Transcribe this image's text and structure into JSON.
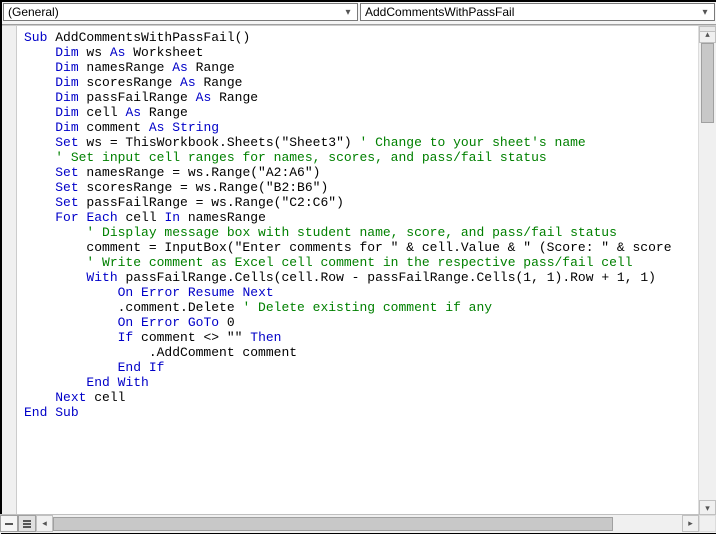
{
  "dropdowns": {
    "object": "(General)",
    "procedure": "AddCommentsWithPassFail"
  },
  "code": {
    "lines": [
      {
        "seg": [
          {
            "t": "Sub",
            "c": "kw"
          },
          {
            "t": " AddCommentsWithPassFail()"
          }
        ]
      },
      {
        "seg": [
          {
            "t": "    "
          },
          {
            "t": "Dim",
            "c": "kw"
          },
          {
            "t": " ws "
          },
          {
            "t": "As",
            "c": "kw"
          },
          {
            "t": " Worksheet"
          }
        ]
      },
      {
        "seg": [
          {
            "t": "    "
          },
          {
            "t": "Dim",
            "c": "kw"
          },
          {
            "t": " namesRange "
          },
          {
            "t": "As",
            "c": "kw"
          },
          {
            "t": " Range"
          }
        ]
      },
      {
        "seg": [
          {
            "t": "    "
          },
          {
            "t": "Dim",
            "c": "kw"
          },
          {
            "t": " scoresRange "
          },
          {
            "t": "As",
            "c": "kw"
          },
          {
            "t": " Range"
          }
        ]
      },
      {
        "seg": [
          {
            "t": "    "
          },
          {
            "t": "Dim",
            "c": "kw"
          },
          {
            "t": " passFailRange "
          },
          {
            "t": "As",
            "c": "kw"
          },
          {
            "t": " Range"
          }
        ]
      },
      {
        "seg": [
          {
            "t": "    "
          },
          {
            "t": "Dim",
            "c": "kw"
          },
          {
            "t": " cell "
          },
          {
            "t": "As",
            "c": "kw"
          },
          {
            "t": " Range"
          }
        ]
      },
      {
        "seg": [
          {
            "t": "    "
          },
          {
            "t": "Dim",
            "c": "kw"
          },
          {
            "t": " comment "
          },
          {
            "t": "As",
            "c": "kw"
          },
          {
            "t": " "
          },
          {
            "t": "String",
            "c": "kw"
          }
        ]
      },
      {
        "seg": [
          {
            "t": ""
          }
        ]
      },
      {
        "seg": [
          {
            "t": "    "
          },
          {
            "t": "Set",
            "c": "kw"
          },
          {
            "t": " ws = ThisWorkbook.Sheets(\"Sheet3\") "
          },
          {
            "t": "' Change to your sheet's name",
            "c": "cm"
          }
        ]
      },
      {
        "seg": [
          {
            "t": ""
          }
        ]
      },
      {
        "seg": [
          {
            "t": "    "
          },
          {
            "t": "' Set input cell ranges for names, scores, and pass/fail status",
            "c": "cm"
          }
        ]
      },
      {
        "seg": [
          {
            "t": "    "
          },
          {
            "t": "Set",
            "c": "kw"
          },
          {
            "t": " namesRange = ws.Range(\"A2:A6\")"
          }
        ]
      },
      {
        "seg": [
          {
            "t": "    "
          },
          {
            "t": "Set",
            "c": "kw"
          },
          {
            "t": " scoresRange = ws.Range(\"B2:B6\")"
          }
        ]
      },
      {
        "seg": [
          {
            "t": "    "
          },
          {
            "t": "Set",
            "c": "kw"
          },
          {
            "t": " passFailRange = ws.Range(\"C2:C6\")"
          }
        ]
      },
      {
        "seg": [
          {
            "t": ""
          }
        ]
      },
      {
        "seg": [
          {
            "t": "    "
          },
          {
            "t": "For",
            "c": "kw"
          },
          {
            "t": " "
          },
          {
            "t": "Each",
            "c": "kw"
          },
          {
            "t": " cell "
          },
          {
            "t": "In",
            "c": "kw"
          },
          {
            "t": " namesRange"
          }
        ]
      },
      {
        "seg": [
          {
            "t": "        "
          },
          {
            "t": "' Display message box with student name, score, and pass/fail status",
            "c": "cm"
          }
        ]
      },
      {
        "seg": [
          {
            "t": "        comment = InputBox(\"Enter comments for \" & cell.Value & \" (Score: \" & score"
          }
        ]
      },
      {
        "seg": [
          {
            "t": ""
          }
        ]
      },
      {
        "seg": [
          {
            "t": "        "
          },
          {
            "t": "' Write comment as Excel cell comment in the respective pass/fail cell",
            "c": "cm"
          }
        ]
      },
      {
        "seg": [
          {
            "t": "        "
          },
          {
            "t": "With",
            "c": "kw"
          },
          {
            "t": " passFailRange.Cells(cell.Row - passFailRange.Cells(1, 1).Row + 1, 1)"
          }
        ]
      },
      {
        "seg": [
          {
            "t": "            "
          },
          {
            "t": "On",
            "c": "kw"
          },
          {
            "t": " "
          },
          {
            "t": "Error",
            "c": "kw"
          },
          {
            "t": " "
          },
          {
            "t": "Resume",
            "c": "kw"
          },
          {
            "t": " "
          },
          {
            "t": "Next",
            "c": "kw"
          }
        ]
      },
      {
        "seg": [
          {
            "t": "            .comment.Delete "
          },
          {
            "t": "' Delete existing comment if any",
            "c": "cm"
          }
        ]
      },
      {
        "seg": [
          {
            "t": "            "
          },
          {
            "t": "On",
            "c": "kw"
          },
          {
            "t": " "
          },
          {
            "t": "Error",
            "c": "kw"
          },
          {
            "t": " "
          },
          {
            "t": "GoTo",
            "c": "kw"
          },
          {
            "t": " 0"
          }
        ]
      },
      {
        "seg": [
          {
            "t": "            "
          },
          {
            "t": "If",
            "c": "kw"
          },
          {
            "t": " comment <> \"\" "
          },
          {
            "t": "Then",
            "c": "kw"
          }
        ]
      },
      {
        "seg": [
          {
            "t": "                .AddComment comment"
          }
        ]
      },
      {
        "seg": [
          {
            "t": "            "
          },
          {
            "t": "End",
            "c": "kw"
          },
          {
            "t": " "
          },
          {
            "t": "If",
            "c": "kw"
          }
        ]
      },
      {
        "seg": [
          {
            "t": "        "
          },
          {
            "t": "End",
            "c": "kw"
          },
          {
            "t": " "
          },
          {
            "t": "With",
            "c": "kw"
          }
        ]
      },
      {
        "seg": [
          {
            "t": "    "
          },
          {
            "t": "Next",
            "c": "kw"
          },
          {
            "t": " cell"
          }
        ]
      },
      {
        "seg": [
          {
            "t": ""
          },
          {
            "t": "End",
            "c": "kw"
          },
          {
            "t": " "
          },
          {
            "t": "Sub",
            "c": "kw"
          }
        ]
      }
    ]
  }
}
